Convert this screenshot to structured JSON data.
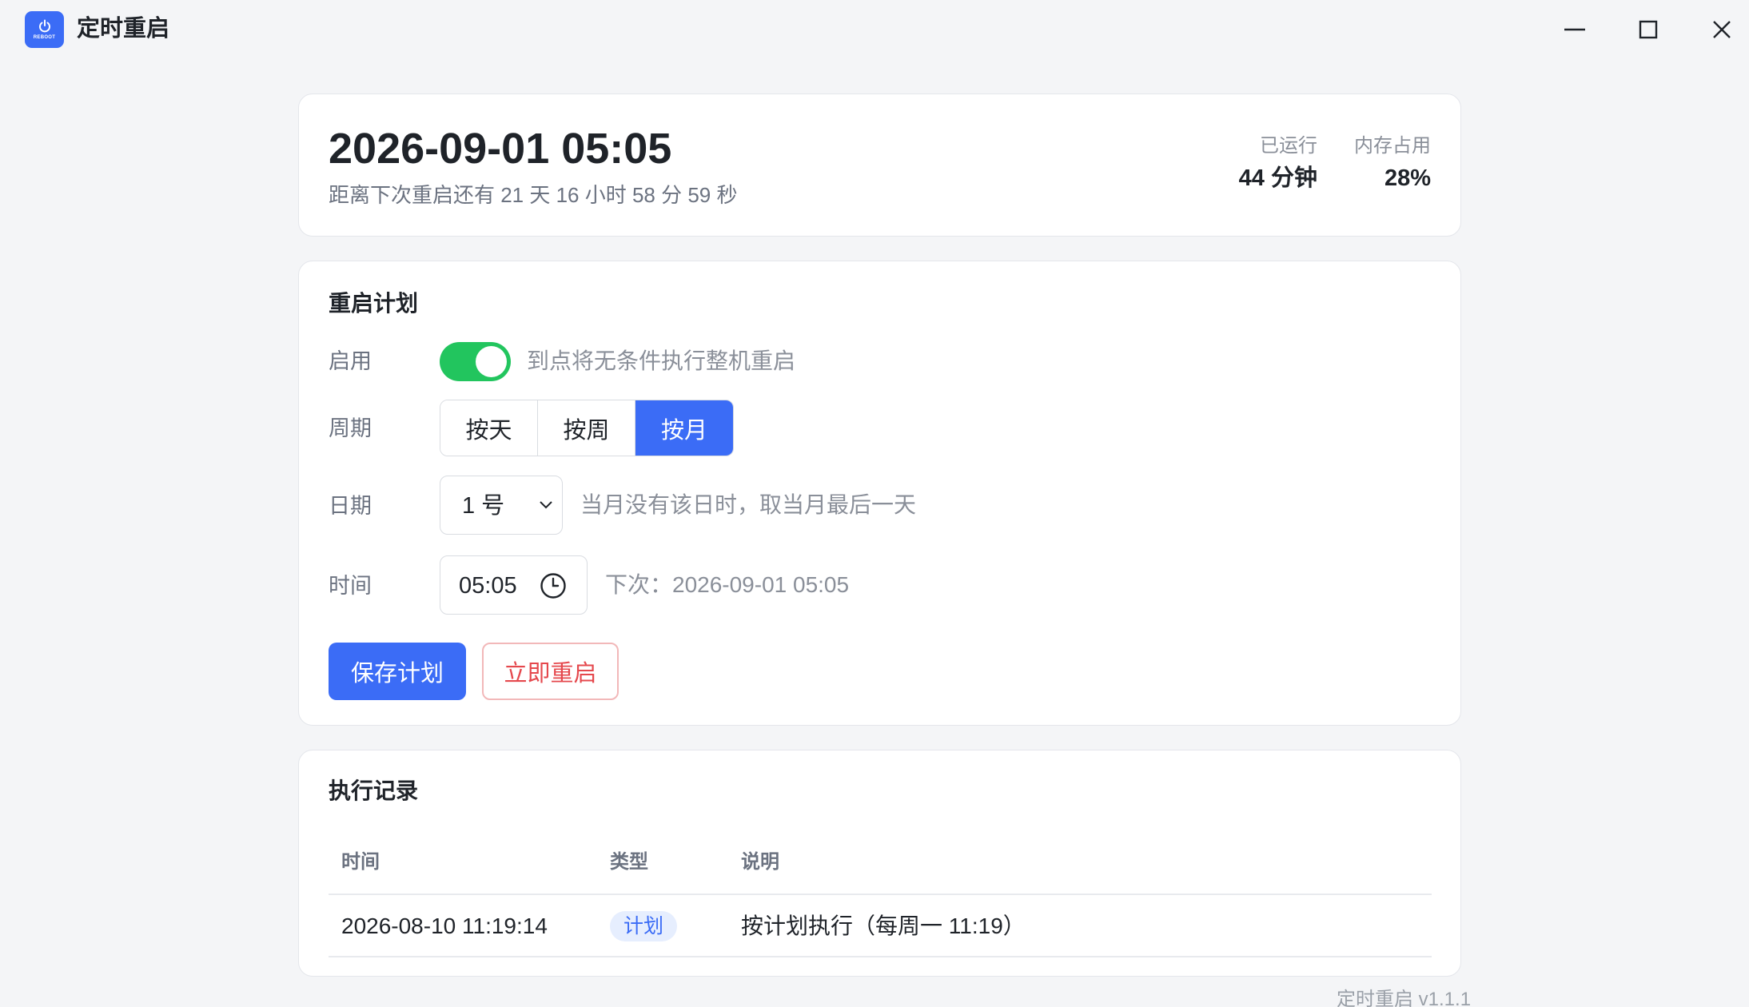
{
  "window": {
    "title": "定时重启",
    "icon_label": "REBOOT",
    "controls": [
      "minimize-icon",
      "maximize-icon",
      "close-icon"
    ]
  },
  "status": {
    "next_reboot": "2026-09-01 05:05",
    "countdown": "距离下次重启还有 21 天 16 小时 58 分 59 秒",
    "uptime_label": "已运行",
    "uptime_value": "44 分钟",
    "memory_label": "内存占用",
    "memory_value": "28%"
  },
  "plan": {
    "heading": "重启计划",
    "enable_label": "启用",
    "enabled": true,
    "enable_hint": "到点将无条件执行整机重启",
    "period_label": "周期",
    "period_options": [
      "按天",
      "按周",
      "按月"
    ],
    "period_selected": "按月",
    "date_label": "日期",
    "date_value": "1 号",
    "date_hint": "当月没有该日时，取当月最后一天",
    "time_label": "时间",
    "time_value": "05:05",
    "next_hint": "下次：2026-09-01 05:05",
    "save_label": "保存计划",
    "reboot_label": "立即重启"
  },
  "log": {
    "heading": "执行记录",
    "columns": [
      "时间",
      "类型",
      "说明"
    ],
    "rows": [
      {
        "time": "2026-08-10 11:19:14",
        "type": "计划",
        "desc": "按计划执行（每周一 11:19）"
      }
    ]
  },
  "footer": {
    "version": "定时重启 v1.1.1"
  },
  "colors": {
    "accent": "#3b6cf6",
    "success": "#22c55e",
    "danger": "#e5484d",
    "background": "#f4f5f7"
  }
}
